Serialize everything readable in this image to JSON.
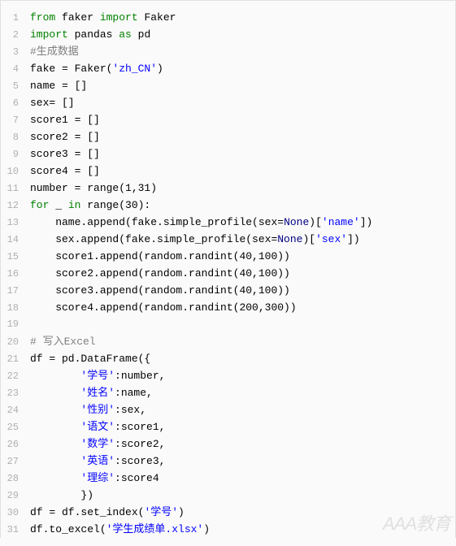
{
  "watermark": "AAA教育",
  "lines": [
    {
      "num": "1",
      "tokens": [
        {
          "t": "kw",
          "v": "from"
        },
        {
          "t": "id",
          "v": " faker "
        },
        {
          "t": "kw",
          "v": "import"
        },
        {
          "t": "id",
          "v": " Faker"
        }
      ]
    },
    {
      "num": "2",
      "tokens": [
        {
          "t": "kw",
          "v": "import"
        },
        {
          "t": "id",
          "v": " pandas "
        },
        {
          "t": "kw",
          "v": "as"
        },
        {
          "t": "id",
          "v": " pd"
        }
      ]
    },
    {
      "num": "3",
      "tokens": [
        {
          "t": "comment",
          "v": "#生成数据"
        }
      ]
    },
    {
      "num": "4",
      "tokens": [
        {
          "t": "id",
          "v": "fake = Faker("
        },
        {
          "t": "str",
          "v": "'zh_CN'"
        },
        {
          "t": "id",
          "v": ")"
        }
      ]
    },
    {
      "num": "5",
      "tokens": [
        {
          "t": "id",
          "v": "name = []"
        }
      ]
    },
    {
      "num": "6",
      "tokens": [
        {
          "t": "id",
          "v": "sex= []"
        }
      ]
    },
    {
      "num": "7",
      "tokens": [
        {
          "t": "id",
          "v": "score1 = []"
        }
      ]
    },
    {
      "num": "8",
      "tokens": [
        {
          "t": "id",
          "v": "score2 = []"
        }
      ]
    },
    {
      "num": "9",
      "tokens": [
        {
          "t": "id",
          "v": "score3 = []"
        }
      ]
    },
    {
      "num": "10",
      "tokens": [
        {
          "t": "id",
          "v": "score4 = []"
        }
      ]
    },
    {
      "num": "11",
      "tokens": [
        {
          "t": "id",
          "v": "number = range(1,31)"
        }
      ]
    },
    {
      "num": "12",
      "tokens": [
        {
          "t": "kw",
          "v": "for"
        },
        {
          "t": "id",
          "v": " _ "
        },
        {
          "t": "kw",
          "v": "in"
        },
        {
          "t": "id",
          "v": " range(30):"
        }
      ]
    },
    {
      "num": "13",
      "tokens": [
        {
          "t": "id",
          "v": "    name.append(fake.simple_profile(sex="
        },
        {
          "t": "none",
          "v": "None"
        },
        {
          "t": "id",
          "v": ")["
        },
        {
          "t": "str",
          "v": "'name'"
        },
        {
          "t": "id",
          "v": "])"
        }
      ]
    },
    {
      "num": "14",
      "tokens": [
        {
          "t": "id",
          "v": "    sex.append(fake.simple_profile(sex="
        },
        {
          "t": "none",
          "v": "None"
        },
        {
          "t": "id",
          "v": ")["
        },
        {
          "t": "str",
          "v": "'sex'"
        },
        {
          "t": "id",
          "v": "])"
        }
      ]
    },
    {
      "num": "15",
      "tokens": [
        {
          "t": "id",
          "v": "    score1.append(random.randint(40,100))"
        }
      ]
    },
    {
      "num": "16",
      "tokens": [
        {
          "t": "id",
          "v": "    score2.append(random.randint(40,100))"
        }
      ]
    },
    {
      "num": "17",
      "tokens": [
        {
          "t": "id",
          "v": "    score3.append(random.randint(40,100))"
        }
      ]
    },
    {
      "num": "18",
      "tokens": [
        {
          "t": "id",
          "v": "    score4.append(random.randint(200,300))"
        }
      ]
    },
    {
      "num": "19",
      "tokens": []
    },
    {
      "num": "20",
      "tokens": [
        {
          "t": "comment",
          "v": "# 写入Excel"
        }
      ]
    },
    {
      "num": "21",
      "tokens": [
        {
          "t": "id",
          "v": "df = pd.DataFrame({"
        }
      ]
    },
    {
      "num": "22",
      "tokens": [
        {
          "t": "id",
          "v": "        "
        },
        {
          "t": "str",
          "v": "'学号'"
        },
        {
          "t": "id",
          "v": ":number,"
        }
      ]
    },
    {
      "num": "23",
      "tokens": [
        {
          "t": "id",
          "v": "        "
        },
        {
          "t": "str",
          "v": "'姓名'"
        },
        {
          "t": "id",
          "v": ":name,"
        }
      ]
    },
    {
      "num": "24",
      "tokens": [
        {
          "t": "id",
          "v": "        "
        },
        {
          "t": "str",
          "v": "'性别'"
        },
        {
          "t": "id",
          "v": ":sex,"
        }
      ]
    },
    {
      "num": "25",
      "tokens": [
        {
          "t": "id",
          "v": "        "
        },
        {
          "t": "str",
          "v": "'语文'"
        },
        {
          "t": "id",
          "v": ":score1,"
        }
      ]
    },
    {
      "num": "26",
      "tokens": [
        {
          "t": "id",
          "v": "        "
        },
        {
          "t": "str",
          "v": "'数学'"
        },
        {
          "t": "id",
          "v": ":score2,"
        }
      ]
    },
    {
      "num": "27",
      "tokens": [
        {
          "t": "id",
          "v": "        "
        },
        {
          "t": "str",
          "v": "'英语'"
        },
        {
          "t": "id",
          "v": ":score3,"
        }
      ]
    },
    {
      "num": "28",
      "tokens": [
        {
          "t": "id",
          "v": "        "
        },
        {
          "t": "str",
          "v": "'理综'"
        },
        {
          "t": "id",
          "v": ":score4"
        }
      ]
    },
    {
      "num": "29",
      "tokens": [
        {
          "t": "id",
          "v": "        })"
        }
      ]
    },
    {
      "num": "30",
      "tokens": [
        {
          "t": "id",
          "v": "df = df.set_index("
        },
        {
          "t": "str",
          "v": "'学号'"
        },
        {
          "t": "id",
          "v": ")"
        }
      ]
    },
    {
      "num": "31",
      "tokens": [
        {
          "t": "id",
          "v": "df.to_excel("
        },
        {
          "t": "str",
          "v": "'学生成绩单.xlsx'"
        },
        {
          "t": "id",
          "v": ")"
        }
      ]
    }
  ]
}
